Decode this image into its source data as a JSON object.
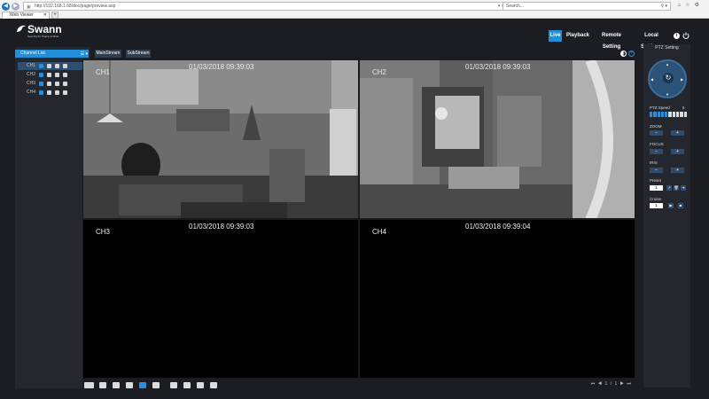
{
  "browser": {
    "address": "http://192.168.1.68/doc/page/preview.asp",
    "search_placeholder": "Search...",
    "tab_title": "Web Viewer",
    "back_icon": "back-arrow-icon",
    "newtab_label": "+"
  },
  "app": {
    "logo_text": "Swann",
    "logo_sub": "Security for Peace of Mind",
    "nav": [
      {
        "label": "Live",
        "active": true
      },
      {
        "label": "Playback",
        "active": false
      },
      {
        "label": "Remote Setting",
        "active": false
      },
      {
        "label": "Local Settings",
        "active": false
      }
    ],
    "info_glyph": "i"
  },
  "channels": {
    "header": "Channel List",
    "items": [
      {
        "label": "CH1",
        "selected": true
      },
      {
        "label": "CH2",
        "selected": false
      },
      {
        "label": "CH3",
        "selected": false
      },
      {
        "label": "CH4",
        "selected": false
      }
    ]
  },
  "streams": {
    "main": "MainStream",
    "sub": "SubStream"
  },
  "video": {
    "cells": [
      {
        "name": "CH1",
        "timestamp": "01/03/2018 09:39:03"
      },
      {
        "name": "CH2",
        "timestamp": "01/03/2018 09:39:03"
      },
      {
        "name": "CH3",
        "timestamp": "01/03/2018 09:39:03"
      },
      {
        "name": "CH4",
        "timestamp": "01/03/2018 09:39:04"
      }
    ]
  },
  "pager": {
    "current": "1",
    "separator": "/",
    "total": "1"
  },
  "ptz": {
    "title": "PTZ Setting",
    "speed_label": "PTZ Speed",
    "speed_value": "5",
    "speed_level": 5,
    "speed_max": 10,
    "zoom_label": "ZOOM",
    "focus_label": "FOCUS",
    "iris_label": "IRIS",
    "preset_label": "Preset",
    "preset_value": "1",
    "cruise_label": "Cruise",
    "cruise_value": "1",
    "minus": "−",
    "plus": "+"
  },
  "colors": {
    "accent": "#1e8fd8",
    "panel": "#24272d",
    "background": "#1b1d22"
  }
}
